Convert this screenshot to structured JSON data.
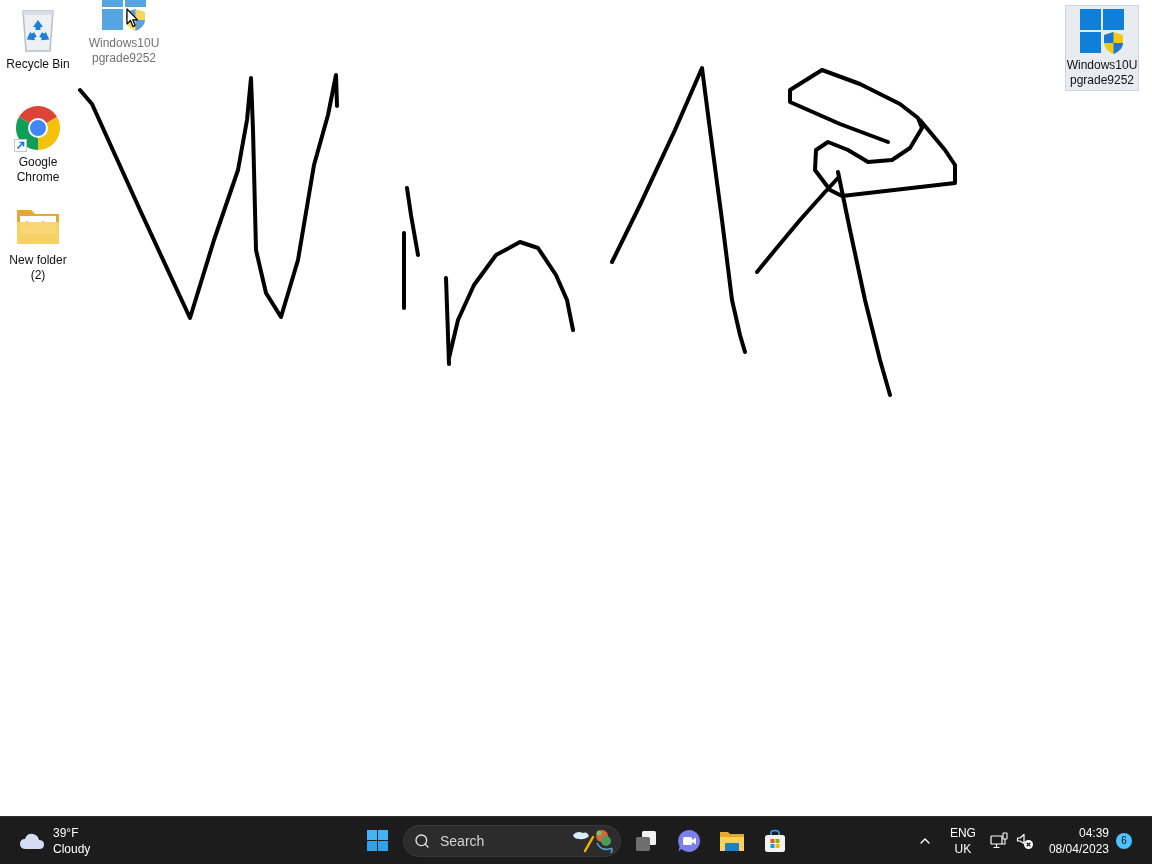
{
  "desktop": {
    "icons": [
      {
        "kind": "recycle-bin",
        "label_lines": [
          "Recycle Bin"
        ],
        "selected": false
      },
      {
        "kind": "chrome",
        "label_lines": [
          "Google",
          "Chrome"
        ],
        "selected": false
      },
      {
        "kind": "folder",
        "label_lines": [
          "New folder",
          "(2)"
        ],
        "selected": false
      }
    ],
    "right_icons": [
      {
        "kind": "windows-upgrade",
        "label_lines": [
          "Windows10U",
          "pgrade9252"
        ],
        "selected": true
      }
    ],
    "drag_ghost": {
      "kind": "windows-upgrade",
      "label_lines": [
        "Windows10U",
        "pgrade9252"
      ]
    }
  },
  "taskbar": {
    "weather": {
      "temperature": "39°F",
      "condition": "Cloudy"
    },
    "search": {
      "placeholder": "Search"
    },
    "pinned": [
      {
        "kind": "task-view"
      },
      {
        "kind": "chat"
      },
      {
        "kind": "file-explorer"
      },
      {
        "kind": "store"
      }
    ],
    "tray": {
      "language": "ENG",
      "region": "UK",
      "time": "04:39",
      "date": "08/04/2023",
      "notifications": "6"
    }
  }
}
